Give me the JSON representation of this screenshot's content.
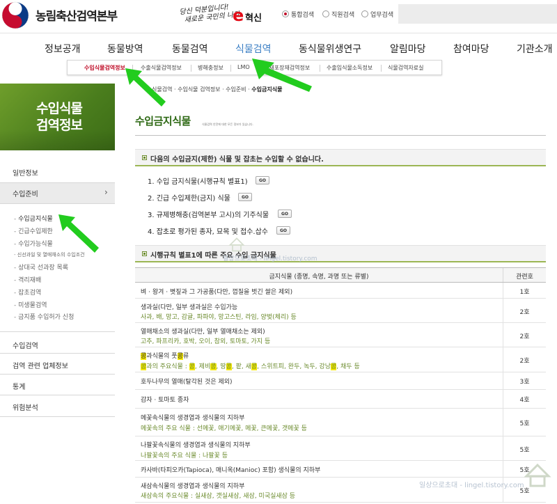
{
  "header": {
    "agency_name": "농림축산검역본부",
    "slogan_line1": "당신 덕분입니다!",
    "slogan_line2": "새로운 국민의 나라",
    "innovation_mark": "e",
    "innovation_label": "혁신",
    "search_scopes": [
      {
        "label": "통합검색",
        "selected": true
      },
      {
        "label": "직원검색",
        "selected": false
      },
      {
        "label": "업무검색",
        "selected": false
      }
    ],
    "search_placeholder": ""
  },
  "gnb": [
    "정보공개",
    "동물방역",
    "동물검역",
    "식물검역",
    "동식물위생연구",
    "알림마당",
    "참여마당",
    "기관소개"
  ],
  "gnb_active": "식물검역",
  "subnav": [
    "수입식물검역정보",
    "수출식물검역정보",
    "병해충정보",
    "LMO",
    "목재포장재검역정보",
    "수출입식물소독정보",
    "식물검역자료실"
  ],
  "subnav_active": "수입식물검역정보",
  "left": {
    "banner_line1": "수입식물",
    "banner_line2": "검역정보",
    "menu": [
      {
        "label": "일반정보"
      },
      {
        "label": "수입준비",
        "active": true,
        "chevron": "›"
      },
      {
        "label": "수입검역"
      },
      {
        "label": "검역 관련 업체정보"
      },
      {
        "label": "통계"
      },
      {
        "label": "위험분석"
      }
    ],
    "submenu": [
      "수입금지식물",
      "긴급수입제한",
      "수입가능식물",
      "신선과일 및 열매채소의 수입조건",
      "상대국 선과장 목록",
      "격리재배",
      "잡초검역",
      "미생물검역",
      "금지품 수입허가 신청"
    ]
  },
  "main": {
    "breadcrumb": [
      "식물검역",
      "수입식물 검역정보",
      "수입준비",
      "수입금지식물"
    ],
    "title": "수입금지식물",
    "title_desc": "식물검역 안전에 대한 모든 정보가 있습니다.",
    "section1_title": "다음의 수입금지(제한) 식물 및 잡초는 수입할 수 없습니다.",
    "prohibited": [
      "1. 수입 금지식물(시행규칙 별표1)",
      "2. 긴급 수입제한(금지) 식물",
      "3. 규제병해충(검역본부 고시)의 기주식물",
      "4. 잡초로 평가된 종자, 묘목 및 접수.삽수"
    ],
    "go_label": "GO",
    "section2_title": "시행규칙 별표1에 따른 주요 수입 금지식물",
    "table_header": [
      "금지식물 (종명, 속명, 과명 또는 류별)",
      "관련호"
    ],
    "rows": [
      {
        "name": "벼 · 왕겨 · 볏짚과 그 가공품(다만, 껍질을 벗긴 쌀은 제외)",
        "sub": "",
        "ref": "1호"
      },
      {
        "name": "생과실(다만, 일부 생과실은 수입가능",
        "sub": "사과, 배, 망고, 감귤, 파파야, 망고스틴, 라임, 양벚(체리) 등",
        "ref": "2호"
      },
      {
        "name": "열매채소의 생과실(다만, 일부 열매채소는 제외)",
        "sub": "고추, 파프리카, 호박, 오이, 참외, 토마토, 가지 등",
        "ref": "2호"
      },
      {
        "name": "콩과식물의 풋콩류",
        "sub": "콩과의 주요식물 : 콩, 제비콩, 땅콩, 팥, 새콩, 스위트피, 완두, 녹두, 강낭콩, 채두 등",
        "ref": "2호"
      },
      {
        "name": "호두나무의 열매(탈각된 것은 제외)",
        "sub": "",
        "ref": "3호"
      },
      {
        "name": "감자 · 토마토 종자",
        "sub": "",
        "ref": "4호"
      },
      {
        "name": "메꽃속식물의 생경엽과 생식물의 지하부",
        "sub": "메꽃속의 주요 식물 : 선메꽃, 애기메꽃, 메꽃, 큰메꽃, 갯메꽃 등",
        "ref": "5호"
      },
      {
        "name": "나팔꽃속식물의 생경엽과 생식물의 지하부",
        "sub": "나팔꽃속의 주요 식물 : 나팔꽃 등",
        "ref": "5호"
      },
      {
        "name": "카사바(타피오카(Tapioca), 매니옥(Manioc) 포함) 생식물의 지하부",
        "sub": "",
        "ref": "5호"
      },
      {
        "name": "새삼속식물의 생경엽과 생식물의 지하부",
        "sub": "새삼속의 주요식물 : 실새삼, 갯실새삼, 새삼, 미국실새삼 등",
        "ref": "5호"
      }
    ]
  },
  "watermark": "일상으로초대 - lingel.tistory.com",
  "accent": "#3a7ec4",
  "title_green": "#2f6a16",
  "arrow_green": "#22cc1e"
}
